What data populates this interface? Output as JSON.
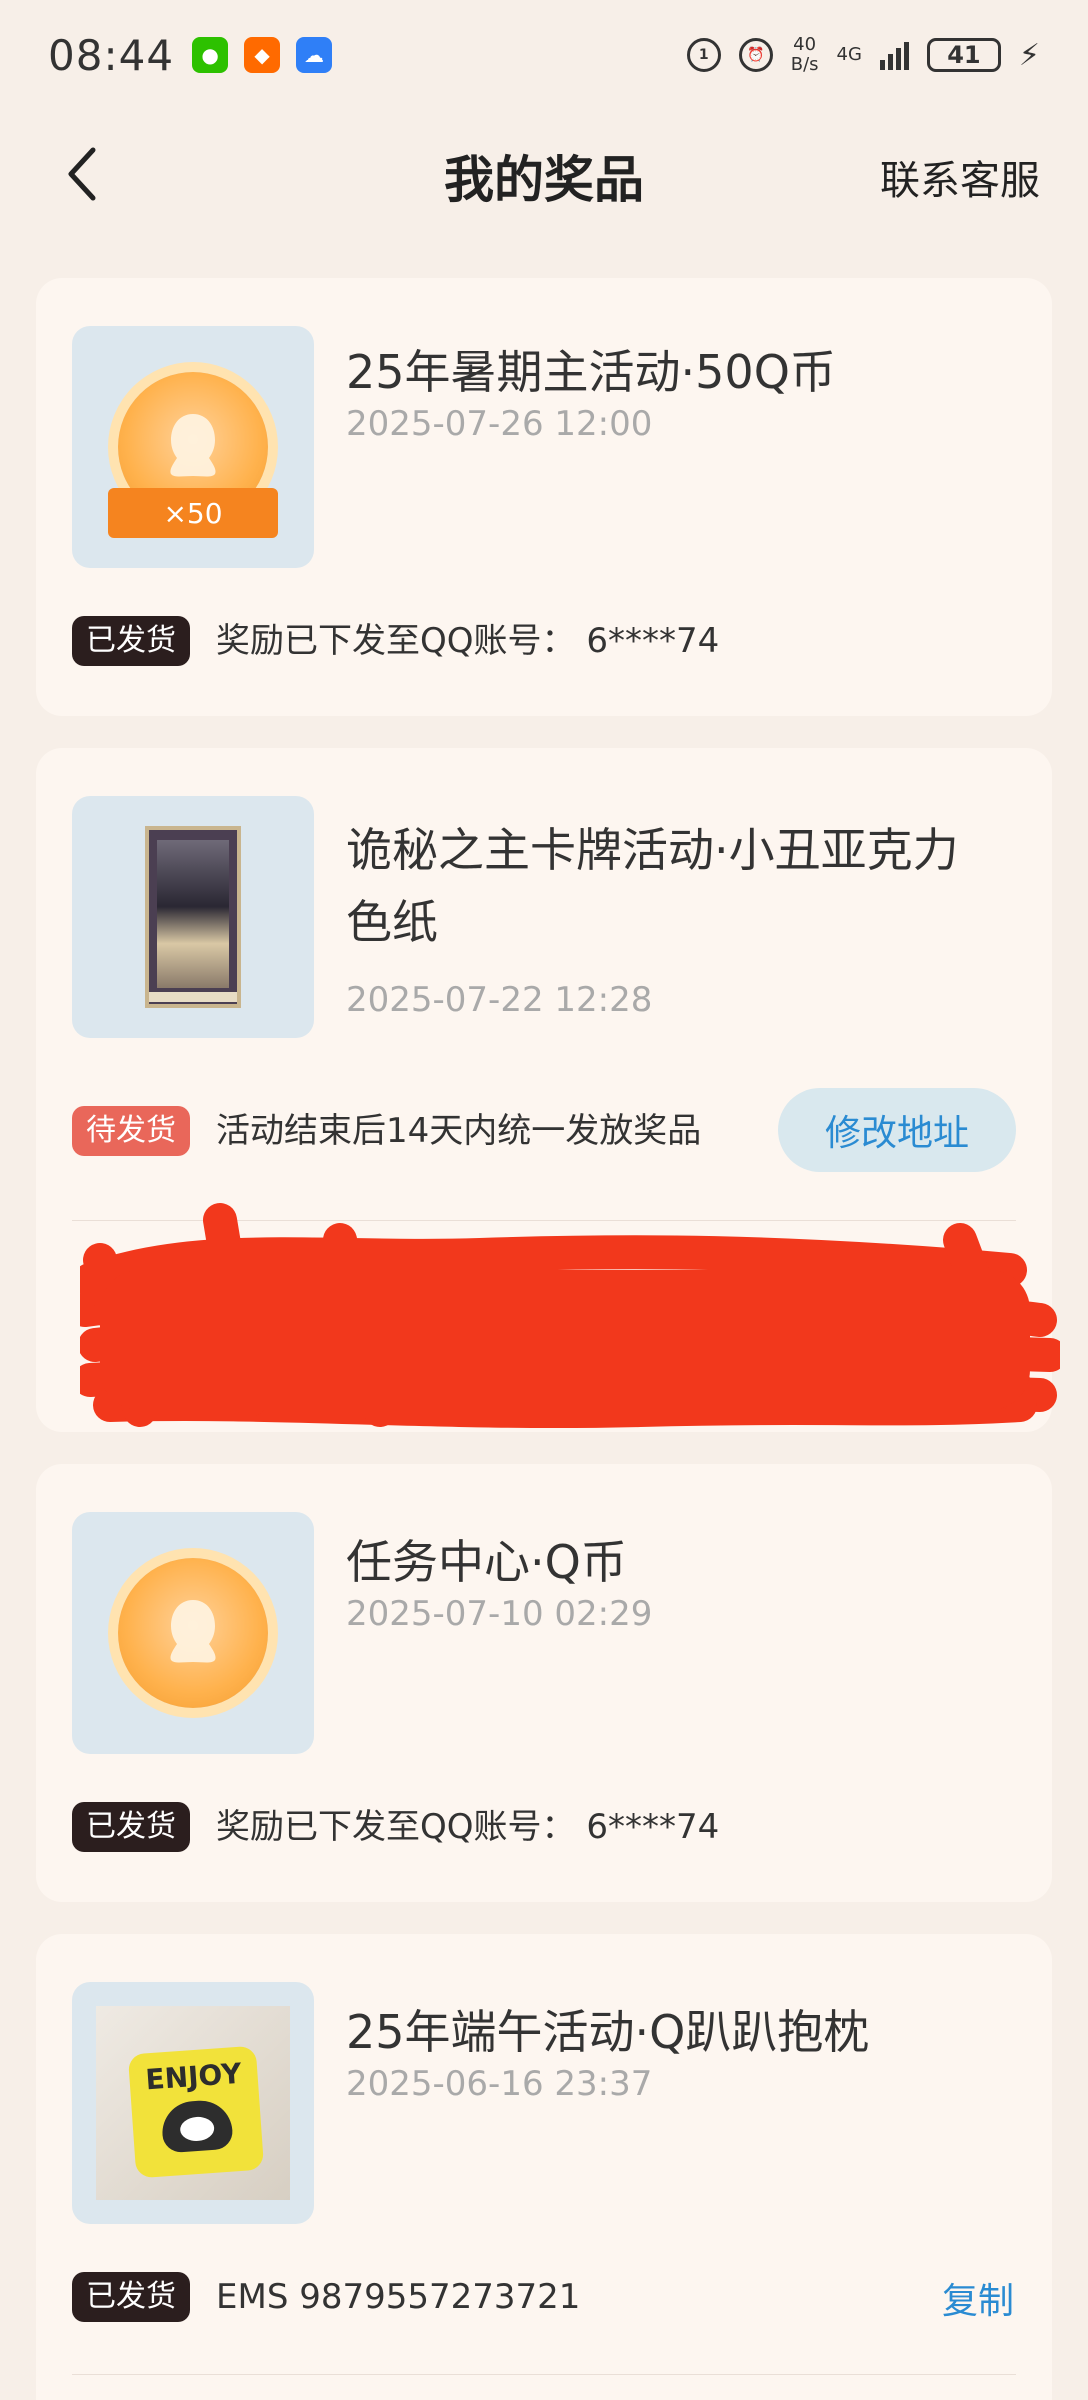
{
  "status_bar": {
    "time": "08:44",
    "net_speed_top": "40",
    "net_speed_bottom": "B/s",
    "network": "4G",
    "battery": "41"
  },
  "header": {
    "title": "我的奖品",
    "contact_service": "联系客服"
  },
  "prizes": [
    {
      "title": "25年暑期主活动·50Q币",
      "date": "2025-07-26 12:00",
      "thumb_tag": "×50",
      "status": "已发货",
      "info": "奖励已下发至QQ账号：  6****74"
    },
    {
      "title_line1": "诡秘之主卡牌活动·小丑亚克力",
      "title_line2": "色纸",
      "date": "2025-07-22 12:28",
      "status": "待发货",
      "info": "活动结束后14天内统一发放奖品",
      "action": "修改地址"
    },
    {
      "title": "任务中心·Q币",
      "date": "2025-07-10 02:29",
      "status": "已发货",
      "info": "奖励已下发至QQ账号：  6****74"
    },
    {
      "title": "25年端午活动·Q趴趴抱枕",
      "date": "2025-06-16 23:37",
      "status": "已发货",
      "info": "EMS 9879557273721",
      "action": "复制",
      "pillow_text": "ENJOY"
    }
  ],
  "colors": {
    "background": "#f7efe8",
    "card": "#fdf6f0",
    "accent_blue": "#2a8bd2",
    "shipped_badge": "#2b1e1e",
    "pending_badge": "#e9675a",
    "redaction": "#f2381c"
  },
  "icons": {
    "back": "chevron-left-icon",
    "coin": "qq-coin-icon"
  }
}
